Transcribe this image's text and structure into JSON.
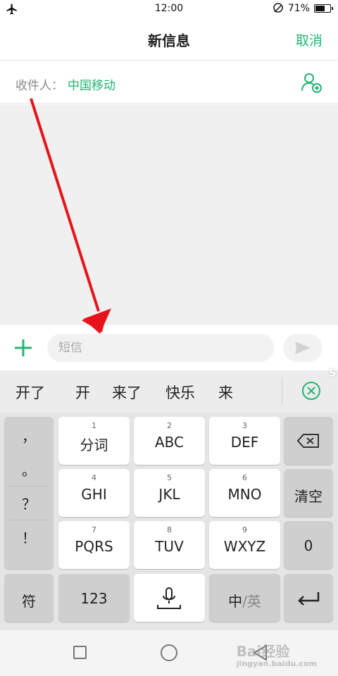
{
  "status_bar": {
    "time": "12:00",
    "battery_percent": "71%",
    "battery_level": 0.71,
    "icons": [
      "airplane-icon",
      "no-signal-icon",
      "battery-icon"
    ]
  },
  "header": {
    "title": "新信息",
    "cancel_label": "取消"
  },
  "recipient": {
    "label": "收件人：",
    "value": "中国移动",
    "add_icon": "add-contact-icon"
  },
  "compose": {
    "placeholder": "短信",
    "plus_icon": "plus-icon",
    "send_icon": "send-icon"
  },
  "keyboard": {
    "candidates": [
      "开了",
      "开",
      "来了",
      "快乐",
      "来"
    ],
    "close_icon": "close-circle-icon",
    "punctuation": [
      "，",
      "。",
      "？",
      "！"
    ],
    "keys": [
      {
        "num": "1",
        "label": "分词"
      },
      {
        "num": "2",
        "label": "ABC"
      },
      {
        "num": "3",
        "label": "DEF"
      },
      {
        "num": "4",
        "label": "GHI"
      },
      {
        "num": "5",
        "label": "JKL"
      },
      {
        "num": "6",
        "label": "MNO"
      },
      {
        "num": "7",
        "label": "PQRS"
      },
      {
        "num": "8",
        "label": "TUV"
      },
      {
        "num": "9",
        "label": "WXYZ"
      }
    ],
    "clear_label": "清空",
    "zero_label": "0",
    "symbol_label": "符",
    "number_label": "123",
    "lang_zh": "中",
    "lang_sep": "/",
    "lang_en": "英",
    "backspace_icon": "backspace-icon",
    "mic_icon": "microphone-icon",
    "enter_icon": "enter-icon"
  },
  "watermark": {
    "brand": "Bai",
    "suffix": "经验",
    "url": "jingyan.baidu.com"
  },
  "colors": {
    "accent": "#22b573",
    "annotation_arrow": "#e8141b",
    "background_area": "#f0f0f0"
  }
}
